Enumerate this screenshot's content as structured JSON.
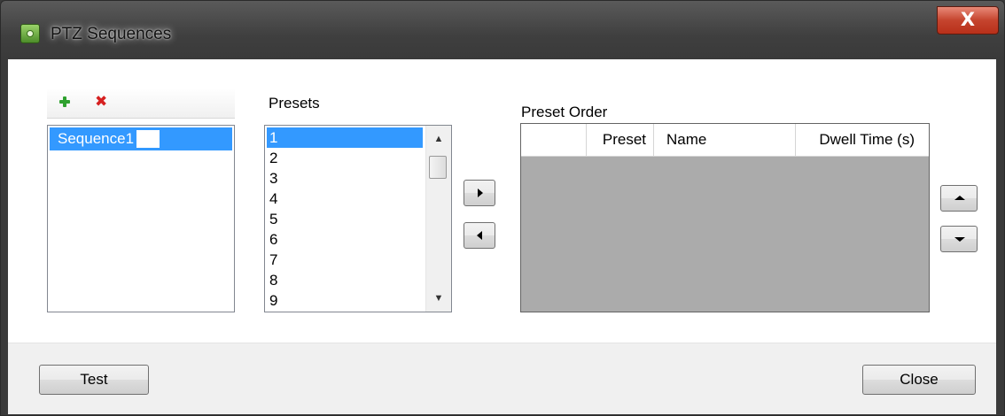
{
  "window": {
    "title": "PTZ Sequences",
    "close_glyph": "X"
  },
  "sequences": {
    "add_icon": "plus-icon",
    "delete_icon": "delete-icon",
    "delete_glyph": "✖",
    "items": [
      {
        "label": "Sequence1",
        "selected": true,
        "editing": true
      }
    ]
  },
  "presets": {
    "label": "Presets",
    "items": [
      "1",
      "2",
      "3",
      "4",
      "5",
      "6",
      "7",
      "8",
      "9"
    ],
    "selected": "1",
    "scroll_up_glyph": "▲",
    "scroll_down_glyph": "▼"
  },
  "move_buttons": {
    "add_icon": "triangle-right-icon",
    "remove_icon": "triangle-left-icon"
  },
  "preset_order": {
    "label": "Preset Order",
    "columns": [
      "Preset",
      "Name",
      "Dwell Time (s)"
    ],
    "rows": []
  },
  "reorder_buttons": {
    "up_icon": "triangle-up-icon",
    "down_icon": "triangle-down-icon"
  },
  "footer": {
    "test_label": "Test",
    "close_label": "Close"
  },
  "colors": {
    "selection": "#3399ff",
    "grid_background": "#ababab",
    "footer_background": "#f0f0f0",
    "close_button": "#c5442e",
    "add_icon": "#2fa12f",
    "delete_icon": "#d62020"
  }
}
